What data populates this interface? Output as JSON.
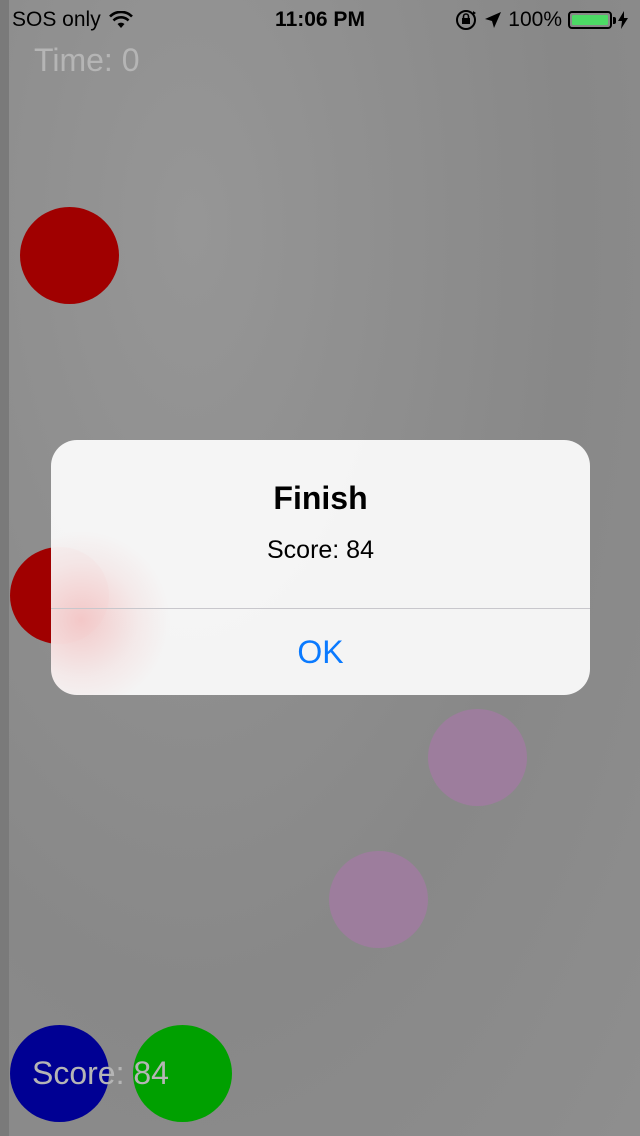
{
  "status_bar": {
    "carrier": "SOS only",
    "wifi_icon": "wifi-icon",
    "time": "11:06 PM",
    "orientation_lock_icon": "orientation-lock-icon",
    "location_icon": "location-arrow-icon",
    "battery_percent": "100%",
    "battery_level": 1.0,
    "battery_color": "#4cd964",
    "charging_icon": "bolt-icon"
  },
  "game": {
    "time_label": "Time: 0",
    "score_label": "Score: 84",
    "colors": {
      "red": "#a00000",
      "purple": "#9d7d9d",
      "blue": "#000093",
      "green": "#00a000"
    }
  },
  "alert": {
    "title": "Finish",
    "message": "Score: 84",
    "ok_label": "OK",
    "ok_color": "#0a7aff"
  }
}
